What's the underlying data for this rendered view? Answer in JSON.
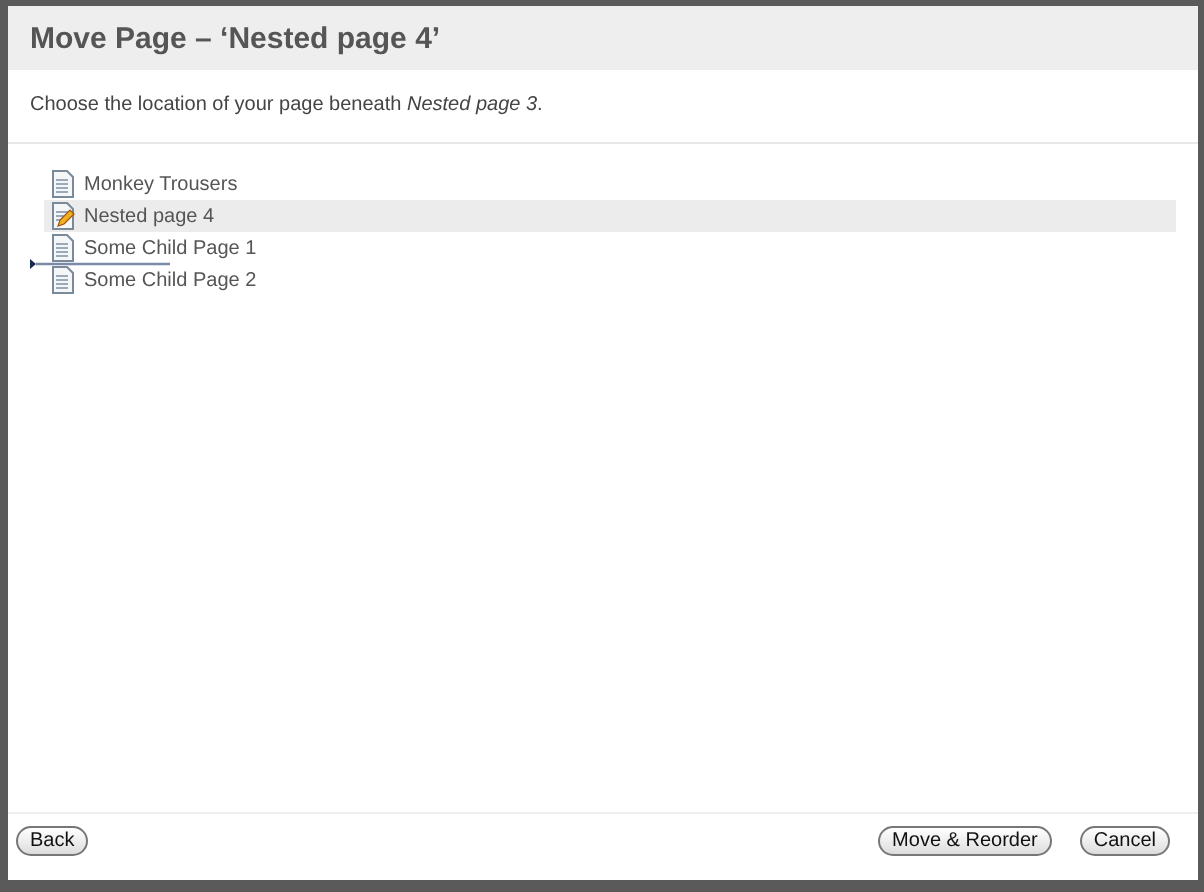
{
  "window": {
    "title": "Move Page – ‘Nested page 4’"
  },
  "description": "Choose the location of your page beneath *Nested page 3*.",
  "pages": [
    {
      "label": "Monkey Trousers",
      "kind": "page",
      "selected": false,
      "drop_after": false
    },
    {
      "label": "Nested page 4",
      "kind": "editing",
      "selected": true,
      "drop_after": false
    },
    {
      "label": "Some Child Page 1",
      "kind": "page",
      "selected": false,
      "drop_after": true
    },
    {
      "label": "Some Child Page 2",
      "kind": "page",
      "selected": false,
      "drop_after": false
    }
  ],
  "buttons": {
    "back": "Back",
    "primary": "Move & Reorder",
    "cancel": "Cancel"
  }
}
